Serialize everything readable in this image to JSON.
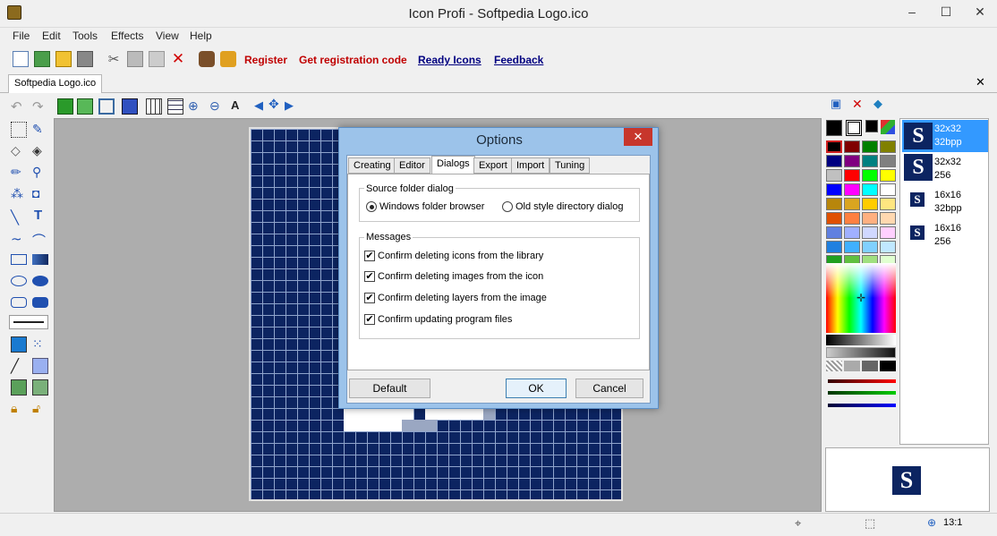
{
  "window": {
    "title": "Icon Profi - Softpedia Logo.ico",
    "minimize": "–",
    "maximize": "☐",
    "close": "✕"
  },
  "menu": [
    "File",
    "Edit",
    "Tools",
    "Effects",
    "View",
    "Help"
  ],
  "toolbar": {
    "links": [
      {
        "label": "Register",
        "color": "#c00000"
      },
      {
        "label": "Get registration code",
        "color": "#c00000"
      },
      {
        "label": "Ready Icons",
        "color": "#000080"
      },
      {
        "label": "Feedback",
        "color": "#000080"
      }
    ]
  },
  "document": {
    "tab": "Softpedia Logo.ico",
    "close": "✕"
  },
  "dialog": {
    "title": "Options",
    "close": "✕",
    "tabs": [
      "Creating",
      "Editor",
      "Dialogs",
      "Export",
      "Import",
      "Tuning"
    ],
    "active_tab": "Dialogs",
    "source_group": "Source folder dialog",
    "radio_windows": "Windows folder browser",
    "radio_old": "Old style directory dialog",
    "messages_group": "Messages",
    "checks": [
      "Confirm deleting icons from the library",
      "Confirm deleting images from the icon",
      "Confirm deleting layers from the image",
      "Confirm updating program files"
    ],
    "btn_default": "Default",
    "btn_ok": "OK",
    "btn_cancel": "Cancel"
  },
  "formats": [
    {
      "line1": "32x32",
      "line2": "32bpp"
    },
    {
      "line1": "32x32",
      "line2": "256"
    },
    {
      "line1": "16x16",
      "line2": "32bpp"
    },
    {
      "line1": "16x16",
      "line2": "256"
    }
  ],
  "logo_letter": "S",
  "status": {
    "zoom": "13:1"
  },
  "palette": [
    "#000000",
    "#800000",
    "#008000",
    "#808000",
    "#000080",
    "#800080",
    "#008080",
    "#808080",
    "#c0c0c0",
    "#ff0000",
    "#00ff00",
    "#ffff00",
    "#0000ff",
    "#ff00ff",
    "#00ffff",
    "#ffffff",
    "#b8860b",
    "#daa520",
    "#ffcc00",
    "#ffe680",
    "#e05000",
    "#ff8040",
    "#ffb080",
    "#ffd8b0",
    "#6080e0",
    "#a0b0ff",
    "#d0d8ff",
    "#ffd0ff",
    "#2080e0",
    "#40b0ff",
    "#80d0ff",
    "#c0e8ff",
    "#20a020",
    "#60c040",
    "#a0e080",
    "#e0ffd0"
  ]
}
